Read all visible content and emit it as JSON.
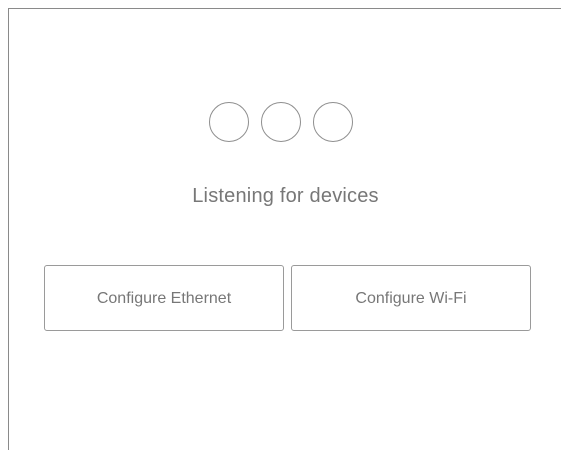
{
  "status": {
    "text": "Listening for devices"
  },
  "actions": {
    "ethernet_label": "Configure Ethernet",
    "wifi_label": "Configure Wi-Fi"
  },
  "indicators": {
    "count": 3,
    "icon": "loading-dots-icon"
  },
  "colors": {
    "background": "#ffffff",
    "border": "#8a8a8a",
    "text": "#777777"
  }
}
